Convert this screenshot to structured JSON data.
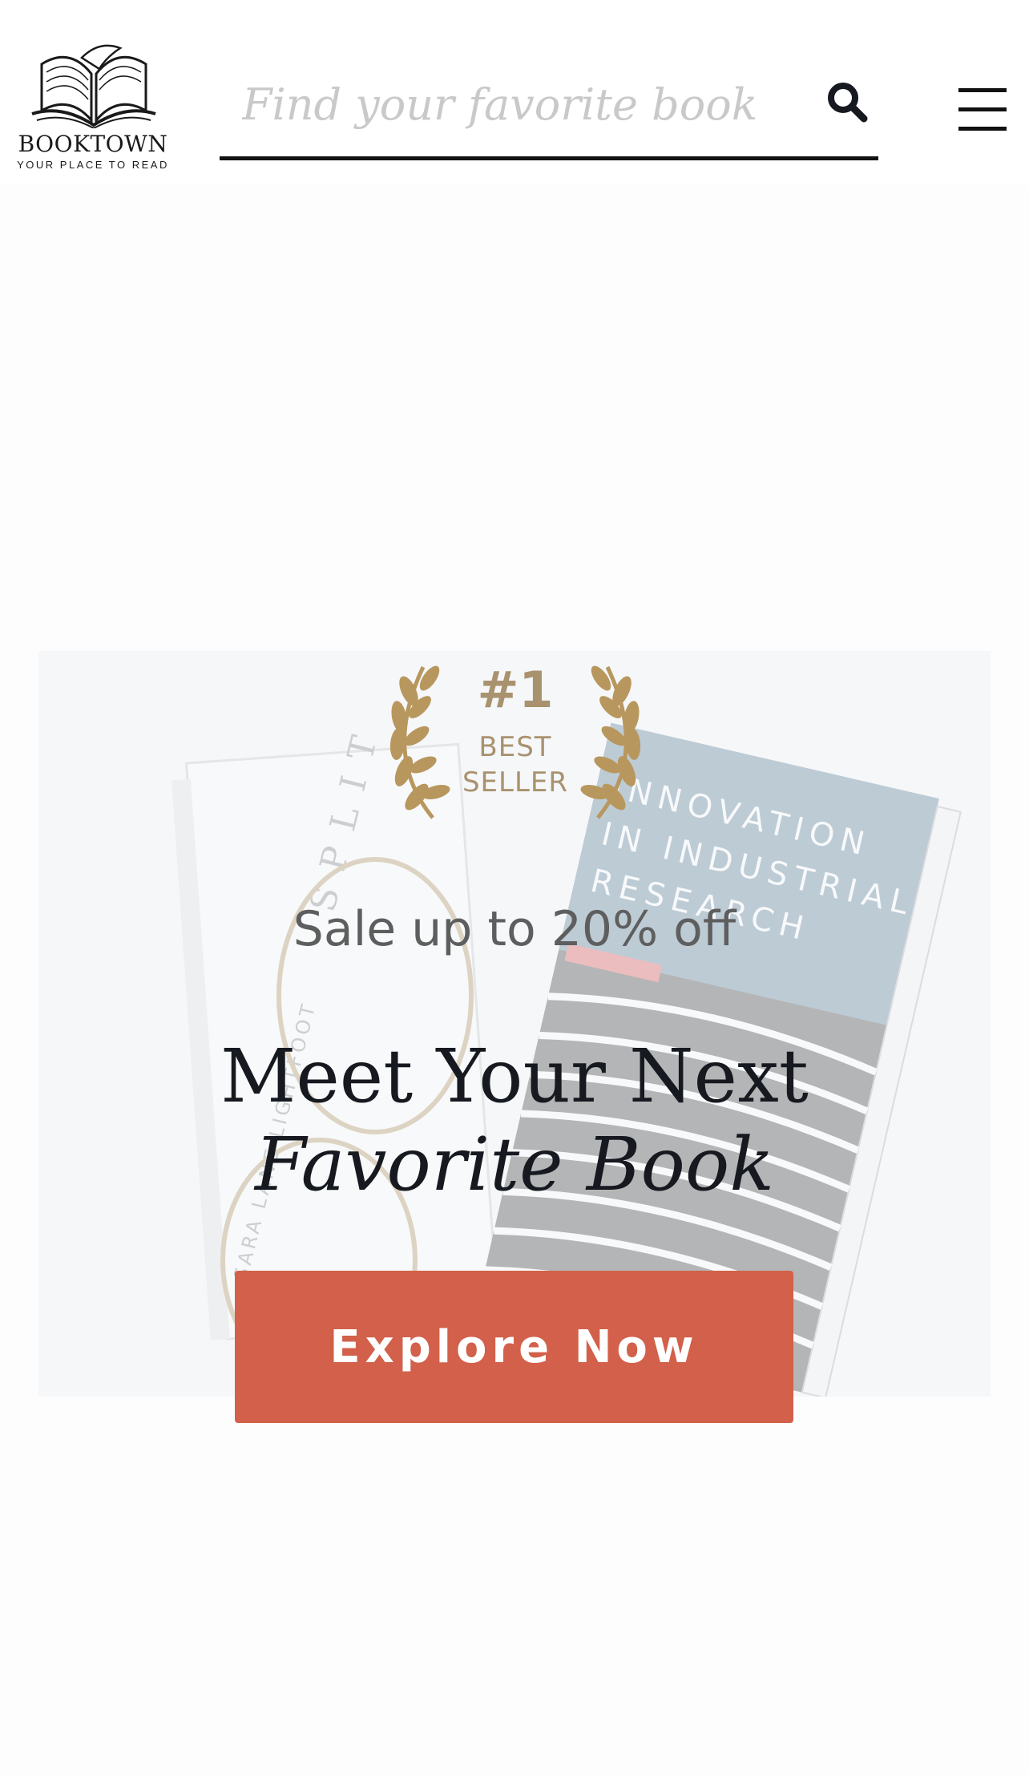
{
  "header": {
    "logo": {
      "name": "BOOKTOWN",
      "tagline": "YOUR PLACE TO READ",
      "icon": "open-book-icon"
    },
    "search": {
      "placeholder": "Find your favorite book",
      "value": "",
      "icon": "search-icon"
    },
    "menu": {
      "icon": "hamburger-menu-icon"
    }
  },
  "hero": {
    "badge": {
      "rank": "#1",
      "label_line1": "BEST",
      "label_line2": "SELLER",
      "icon": "laurel-wreath-icon"
    },
    "book_covers": {
      "left_title": "SPLIT",
      "left_author": "SARA LANE LIGHTFOOT",
      "right_title_line1": "INNOVATION",
      "right_title_line2": "IN INDUSTRIAL",
      "right_title_line3": "RESEARCH"
    },
    "subtitle": "Sale up to 20% off",
    "title_line1": "Meet Your Next",
    "title_line2": "Favorite Book",
    "cta_label": "Explore Now"
  },
  "colors": {
    "accent": "#d2604a",
    "gold": "#a9926e",
    "text_dark": "#16191f",
    "hero_bg": "#f5f7f9"
  }
}
